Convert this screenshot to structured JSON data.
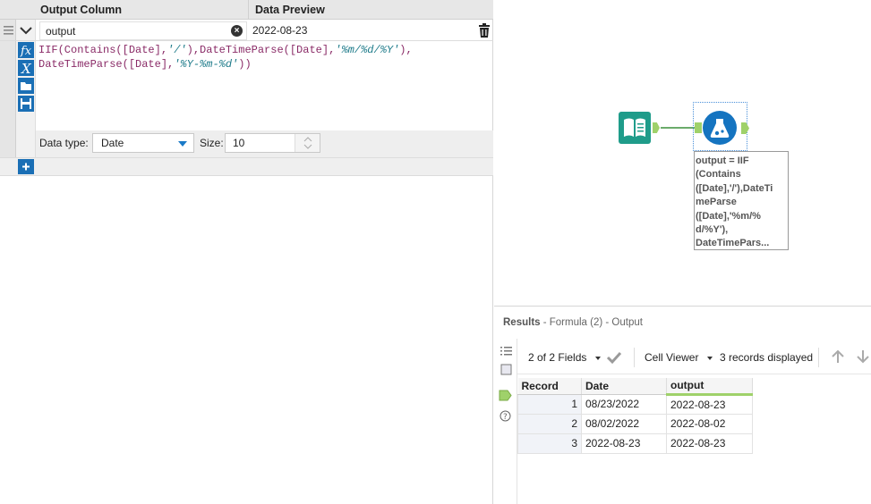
{
  "formula_panel": {
    "col_header_output": "Output Column",
    "col_header_preview": "Data Preview",
    "output_name": "output",
    "preview_value": "2022-08-23",
    "formula_line1": {
      "p1": "IIF(Contains([Date],",
      "s1": "'/'",
      "p2": "),DateTimeParse([Date],",
      "s2": "'%m/%d/%Y'",
      "p3": "),"
    },
    "formula_line2": {
      "p1": "DateTimeParse([Date],",
      "s1": "'%Y-%m-%d'",
      "p2": "))"
    },
    "data_type_label": "Data type:",
    "data_type_value": "Date",
    "size_label": "Size:",
    "size_value": "10"
  },
  "workflow": {
    "annotation_lines": [
      "output = IIF",
      "(Contains",
      "([Date],'/'),DateTi",
      "meParse",
      "([Date],'%m/%",
      "d/%Y'),",
      "DateTimePars..."
    ],
    "colors": {
      "book": "#1f9c8a",
      "tool": "#1574c0",
      "anchor": "#9fd16a",
      "selected": "#4a90d9"
    }
  },
  "results": {
    "title": "Results",
    "subtitle": " - Formula (2) - Output",
    "fields_label": "2 of 2 Fields",
    "cell_viewer_label": "Cell Viewer",
    "records_label": "3 records displayed",
    "columns": [
      "Record",
      "Date",
      "output"
    ],
    "rows": [
      [
        "1",
        "08/23/2022",
        "2022-08-23"
      ],
      [
        "2",
        "08/02/2022",
        "2022-08-02"
      ],
      [
        "3",
        "2022-08-23",
        "2022-08-23"
      ]
    ]
  }
}
